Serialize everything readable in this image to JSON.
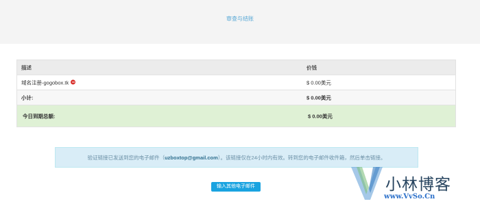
{
  "header": {
    "title": "审查与结账"
  },
  "table": {
    "columns": {
      "description": "描述",
      "price": "价钱"
    },
    "items": [
      {
        "description": "域名注册-gogobox.tk",
        "price": "$ 0.00美元",
        "remove_icon": "remove-circle-icon"
      }
    ],
    "subtotal": {
      "label": "小计:",
      "value": "$ 0.00美元"
    },
    "total_due": {
      "label": "今日到期总额:",
      "value": "$ 0.00美元"
    }
  },
  "notice": {
    "text_before": "验证链接已发送到您的电子邮件（",
    "email": "uzboxtop@gmail.com",
    "text_after": "）。该链接仅在24小时内有效。转到您的电子邮件收件箱，然后单击链接。"
  },
  "actions": {
    "resend_label": "输入其他电子邮件"
  },
  "watermark": {
    "title": "小林博客",
    "url": "www.VvSo.Cn"
  },
  "colors": {
    "accent": "#1aa3e0",
    "title_text": "#5aa9d6",
    "total_row_bg": "#dff1d5",
    "notice_bg": "#d9edf7",
    "remove_icon": "#d9302c"
  }
}
